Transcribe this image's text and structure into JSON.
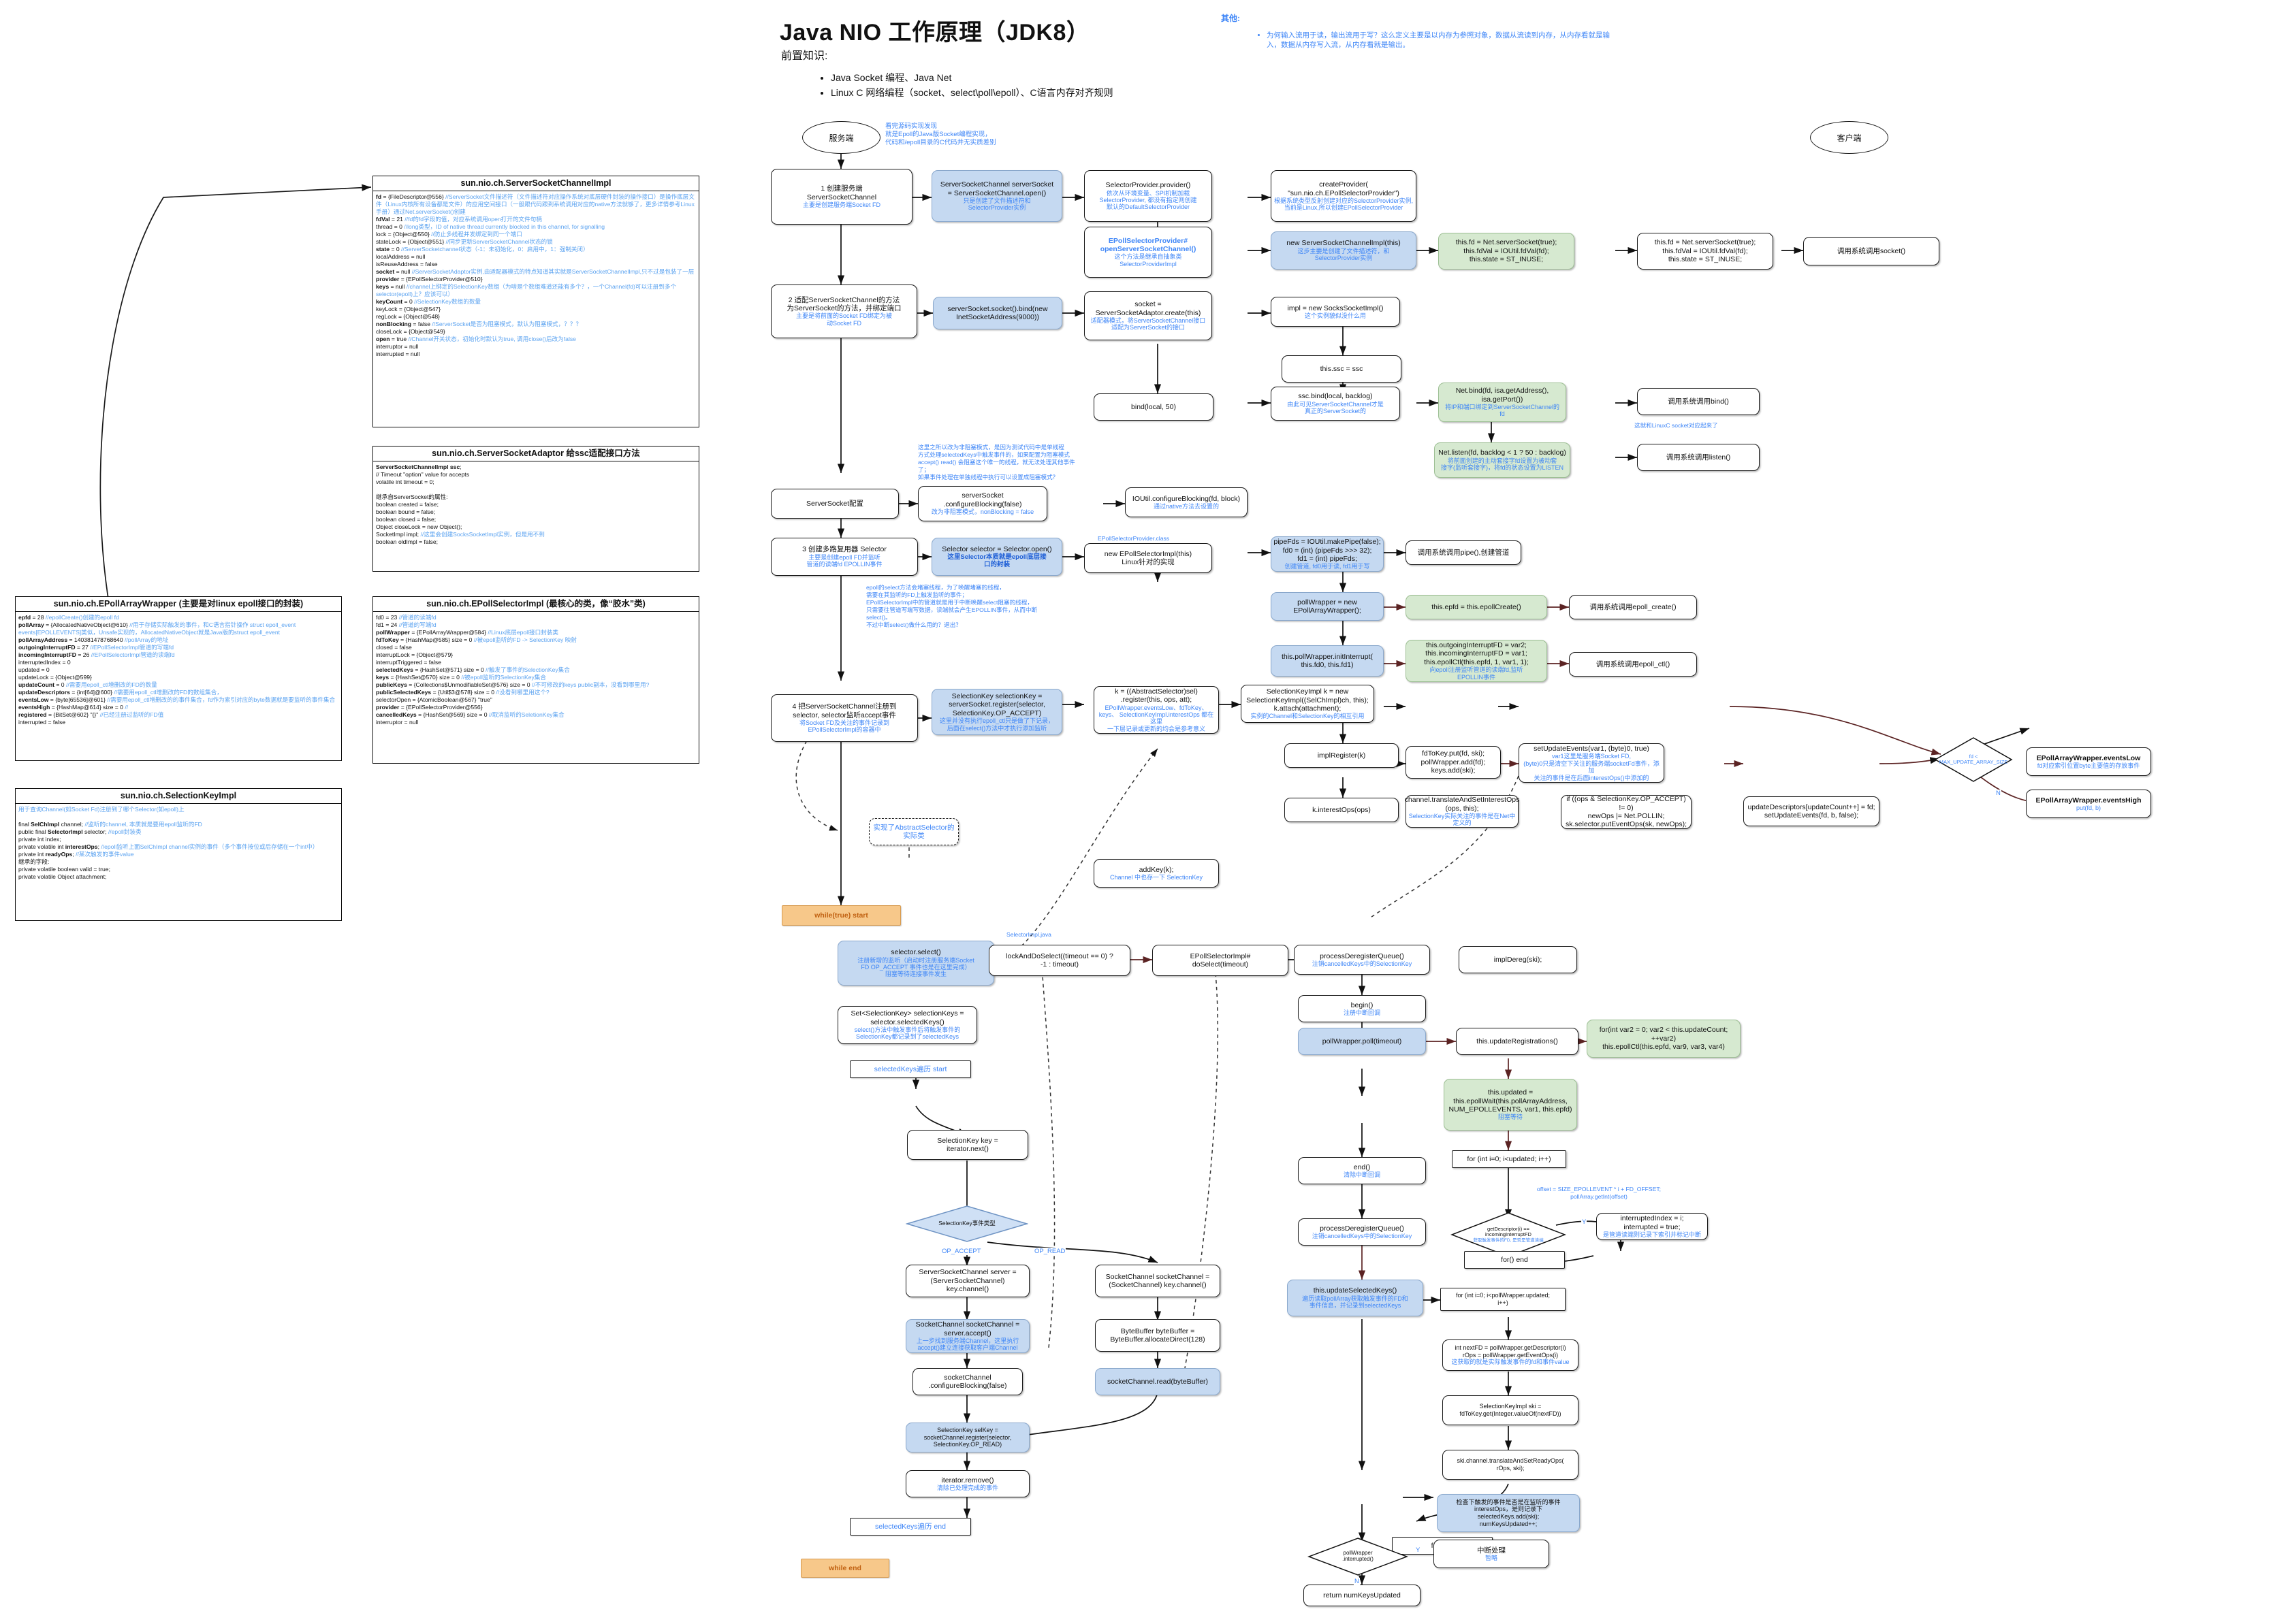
{
  "title": "Java NIO 工作原理（JDK8）",
  "prerequisite": {
    "label": "前置知识:",
    "items": [
      "Java Socket 编程、Java Net",
      "Linux C 网络编程（socket、select\\poll\\epoll）、C语言内存对齐规则"
    ]
  },
  "other": {
    "label": "其他:",
    "items": [
      "为何输入流用于读，输出流用于写？这么定义主要是以内存为参照对象，数据从流读到内存，从内存看就是输入，数据从内存写入流，从内存看就是输出。"
    ]
  },
  "classboxes": [
    {
      "id": "ssci",
      "title": "sun.nio.ch.ServerSocketChannelImpl",
      "lines": [
        "<b>fd</b> = {FileDescriptor@556} <c>//ServerSocket文件描述符（文件描述符对应操作系统对底层硬件封装的操作接口）是操作底层文件（Linux内核所有设备都是文件）的应用空间接口（一般跟代码跟到系统调用对应的native方法就够了，更多详情参考Linux手册）通过Net.serverSocket()创建</c>",
        "<b>fdVal</b> = 21 <c>//fd的fd字段的值，对应系统调用open打开的文件句柄</c>",
        "thread = 0 <c>//long类型，ID of native thread currently blocked in this channel, for signalling</c>",
        "lock = {Object@550}  <c>//防止多线程并发绑定到同一个端口</c>",
        "stateLock = {Object@551} <c>//同步更新ServerSocketChannel状态的锁</c>",
        "<b>state</b> = 0 <c>//ServerSocketchannel状态（-1：未初始化，0：启用中，1：强制关闭）</c>",
        "localAddress = null",
        "isReuseAddress = false",
        "<b>socket</b> = null <c>//ServerSocketAdaptor实例,由适配器模式的特点知道其实就是ServerSocketChannelImpl,只不过是包装了一层</c>",
        "<b>provider</b> = {EPollSelectorProvider@510}",
        "<b>keys</b> = null <c>//channel上绑定的SelectionKey数组（为啥是个数组难道还能有多个？，一个Channel(fd)可以注册到多个selector(epoll)上？应该可以）</c>",
        "<b>keyCount</b> = 0 <c>//SelectionKey数组的数量</c>",
        "keyLock = {Object@547}",
        "regLock = {Object@548}",
        "<b>nonBlocking</b> = false <c>//ServerSocket是否为阻塞模式，默认为阻塞模式，？？？</c>",
        "closeLock = {Object@549}",
        "<b>open</b> = true    <c>//Channel开关状态，初始化时默认为true, 调用close()后改为false</c>",
        "interruptor = null",
        "interrupted = null"
      ]
    },
    {
      "id": "ssa",
      "title": "sun.nio.ch.ServerSocketAdaptor    给ssc适配接口方法",
      "lines": [
        "<b>ServerSocketChannelImpl ssc</b>;",
        "// Timeout \"option\" value for accepts",
        "volatile int timeout = 0;",
        "&nbsp;",
        "继承自ServerSocket的属性:",
        "boolean created = false;",
        "boolean bound = false;",
        "boolean closed = false;",
        "Object closeLock = new Object();",
        "SocketImpl impl; <c>//这里会创建SocksSocketImpl实例，但是用不到</c>",
        "boolean oldImpl = false;"
      ]
    },
    {
      "id": "epaw",
      "title": "sun.nio.ch.EPollArrayWrapper (主要是对linux epoll接口的封装)",
      "lines": [
        "<b>epfd</b> = 28              <c>//epollCreate()创建的epoll fd</c>",
        "<b>pollArray</b> = {AllocatedNativeObject@610} <c>//用于存储实际触发的事件，和C语言指针操作 struct epoll_event events[EPOLLEVENTS]类似，Unsafe实现的，AllocatedNativeObject就是Java版的struct epoll_event</c>",
        "<b>pollArrayAddress</b> = 140381478768640    <c>//pollArray的地址</c>",
        "<b>outgoingInterruptFD</b> = 27        <c>//EPollSelectorImpl管道的写端fd</c>",
        "<b>incomingInterruptFD</b> = 26        <c>//EPollSelectorImpl管道的读端fd</c>",
        "interruptedIndex = 0",
        "updated = 0",
        "updateLock = {Object@599}",
        "<b>updateCount</b> = 0                <c>//需要用epoll_ctl增删改的FD的数量</c>",
        "<b>updateDescriptors</b> = {int[64]@600} <c>//需要用epoll_ctl增删改的FD的数组集合，</c>",
        "<b>eventsLow</b> = {byte[65536]@601}       <c>//需要用epoll_ctl增删改的的事件集合，fd作为索引对应的byte数据就是要监听的事件集合</c>",
        "<b>eventsHigh</b> = {HashMap@614}  size = 0   <c>//</c>",
        "<b>registered</b> = {BitSet@602} \"{}\" <c>//已经注册过监听的FD值</c>",
        "interrupted = false"
      ]
    },
    {
      "id": "epsi",
      "title": "sun.nio.ch.EPollSelectorImpl (最核心的类，像“胶水”类)",
      "lines": [
        "fd0 = 23 <c>//管道的读端fd</c>",
        "fd1 = 24 <c>//管道的写端fd</c>",
        "<b>pollWrapper</b> = {EPollArrayWrapper@584} <c>//Linux底层epoll接口封装类</c>",
        "<b>fdToKey</b> = {HashMap@585} size = 0 <c>//被epoll监听的FD -> SelectionKey 映射</c>",
        "closed = false",
        "interruptLock = {Object@579}",
        "interruptTriggered = false",
        "<b>selectedKeys</b> = {HashSet@571} size = 0     <c>//触发了事件的SelectionKey集合</c>",
        "<b>keys</b> = {HashSet@570} size = 0 <c>//被epoll监听的SelectionKey集合</c>",
        "<b>publicKeys</b> = {Collections$UnmodifiableSet@576} size = 0 <c>//不可修改的keys public副本，没看到哪里用?</c>",
        "<b>publicSelectedKeys</b> = {Util$3@578} size = 0 <c>//没看到哪里用这个?</c>",
        "selectorOpen = {AtomicBoolean@567} \"true\"",
        "<b>provider</b> = {EPollSelectorProvider@556}",
        "<b>cancelledKeys</b> = {HashSet@569} size = 0  <c>//取消监听的SeletionKey集合</c>",
        "interruptor = null"
      ]
    },
    {
      "id": "ski",
      "title": "sun.nio.ch.SelectionKeyImpl",
      "lines": [
        "<c>用于查询Channel(如Socket Fd)注册到了哪个Selector(如epoll)上</c>",
        "&nbsp;",
        "final <b>SelChImpl</b> channel; <c>//监听的channel, 本质就是要用epoll监听的FD</c>",
        "public final <b>SelectorImpl</b> selector; <c>//epoll封装类</c>",
        "private int index;",
        "private volatile int <b>interestOps</b>; <c>//epoll监听上面SelChImpl channel实例的事件（多个事件按位或后存储在一个int中）</c>",
        "private int <b>readyOps</b>;   <c>//某次触发的事件value</c>",
        "继承的字段:",
        "private volatile boolean valid = true;",
        "private volatile Object attachment;"
      ]
    }
  ],
  "lanes": {
    "server": "服务端",
    "client": "客户端"
  },
  "nodes": {
    "n_server_note": "看完源码实现发现\n就是Epoll的Java版Socket编程实现，\n代码和/epoll目录的C代码并无实质差别",
    "n1": {
      "main": "1 创建服务端\nServerSocketChannel",
      "sub": "主要是创建服务端Socket FD"
    },
    "n1r": {
      "main": "ServerSocketChannel serverSocket\n= ServerSocketChannel.open()",
      "sub": "只是创建了文件描述符和\nSelectorProvider实例"
    },
    "n_sp_provider": {
      "main": "SelectorProvider.provider()",
      "sub": "依次从环境变量、SPI机制加载\nSelectorProvider, 都没有指定则创建\n默认的DefaultSelectorProvider"
    },
    "n_createprovider": {
      "main": "createProvider(\n\"sun.nio.ch.EPollSelectorProvider\")",
      "sub": "根据系统类型反射创建对应的SelectorProvider实例,\n当前是Linux,所以创建EPollSelectorProvider"
    },
    "n_openssc": {
      "main": "EPollSelectorProvider#\nopenServerSocketChannel()",
      "sub": "这个方法是继承自抽象类\nSelectorProviderImpl"
    },
    "n_newsscimpl": {
      "main": "new ServerSocketChannelImpl(this)",
      "sub": "这步主要是创建了文件描述符，和\nSelectorProvider实例"
    },
    "n_netserversocket_g": {
      "main": "this.fd = Net.serverSocket(true);\nthis.fdVal = IOUtil.fdVal(fd);\nthis.state = ST_INUSE;"
    },
    "n_netserversocket_w": {
      "main": "this.fd = Net.serverSocket(true);\nthis.fdVal = IOUtil.fdVal(fd);\nthis.state = ST_INUSE;"
    },
    "n_syscall_socket": {
      "main": "调用系统调用socket()"
    },
    "n2": {
      "main": "2 适配ServerSocketChannel的方法\n为ServerSocket的方法，并绑定端口",
      "sub": "主要是将前面的Socket FD绑定为被\n动Socket FD"
    },
    "n2r": {
      "main": "serverSocket.socket().bind(new\nInetSocketAddress(9000))"
    },
    "n_ssa_create": {
      "main": "socket =\nServerSocketAdaptor.create(this)",
      "sub": "适配器模式，将ServerSocketChannel接口\n适配为ServerSocket的接口"
    },
    "n_socksimpl": {
      "main": "impl = new SocksSocketImpl()",
      "sub": "这个实例貌似没什么用"
    },
    "n_thisssc": {
      "main": "this.ssc = ssc"
    },
    "n_bindlocal50": {
      "main": "bind(local, 50)"
    },
    "n_sscbind": {
      "main": "ssc.bind(local, backlog)",
      "sub": "由此可见ServerSocketChannel才是\n真正的ServerSocket的"
    },
    "n_netbind": {
      "main": "Net.bind(fd, isa.getAddress(),\nisa.getPort())",
      "sub": "将IP和端口绑定到ServerSocketChannel的\nfd"
    },
    "n_syscall_bind": {
      "main": "调用系统调用bind()"
    },
    "n_netlisten": {
      "main": "Net.listen(fd, backlog < 1 ? 50 : backlog)",
      "sub": "将前面创建的主动套接字fd设置为被动套\n接字(监听套接字)，将fd的状态设置为LISTEN"
    },
    "n_syscall_listen": {
      "main": "调用系统调用listen()"
    },
    "n_linuxc_note": "这就和LinuxC socket对应起来了",
    "n3cfg": {
      "main": "ServerSocket配置"
    },
    "n3cfg_r": {
      "main": "serverSocket\n.configureBlocking(false)",
      "sub": "改为非阻塞模式，nonBlocking = false"
    },
    "n3cfg_note": "这里之所以改为非阻塞模式，是因为测试代码中是单线程\n方式处理selectedKeys中触发事件的，如果配置为阻塞模式\naccept() read() 会阻塞这个唯一的线程，就无法处理其他事件\n了；\n如果事件处理在单独线程中执行可以设置成阻塞模式？",
    "n_ioutilcfgblk": {
      "main": "IOUtil.configureBlocking(fd, block)",
      "sub": "通过native方法去设置的"
    },
    "n3": {
      "main": "3 创建多路复用器 Selector",
      "sub": "主要是创建epoll FD并监听\n管道的读端fd EPOLLIN事件"
    },
    "n3r": {
      "main": "Selector selector = Selector.open()",
      "subb": "这里Selector本质就是epoll底层接\n口的封装"
    },
    "n3r2": {
      "main": "EPollSelectorProvider.class"
    },
    "n3r3": {
      "main": "new EPollSelectorImpl(this)\nLinux针对的实现"
    },
    "n3_note": "epoll的select方法会堵塞线程，为了唤醒堵塞的线程，\n需要在其监听的FD上触发监听的事件；\nEPollSelectorImpl中的管道就是用于中断唤醒select阻塞的线程，\n只需要往管道写端写数据，读端就会产生EPOLLIN事件，从而中断\nselect()。\n不过中断select()做什么用的？退出？",
    "n_makepipe": {
      "main": "pipeFds = IOUtil.makePipe(false);\nfd0 = (int) (pipeFds >>> 32);\nfd1 = (int) pipeFds;",
      "sub": "创建管道, fd0用于读, fd1用于写"
    },
    "n_syscall_pipe": {
      "main": "调用系统调用pipe(),创建管道"
    },
    "n_newepaw": {
      "main": "pollWrapper = new\nEPollArrayWrapper();"
    },
    "n_epollcreate": {
      "main": "this.epfd = this.epollCreate()"
    },
    "n_syscall_epollcreate": {
      "main": "调用系统调用epoll_create()"
    },
    "n_initinterrupt": {
      "main": "this.pollWrapper.initInterrupt(\nthis.fd0, this.fd1)"
    },
    "n_epollctl_init": {
      "main": "this.outgoingInterruptFD = var2;\nthis.incomingInterruptFD = var1;\nthis.epollCtl(this.epfd, 1, var1, 1);",
      "sub": "向epoll注册监听管道的读端fd,监听\nEPOLLIN事件"
    },
    "n_syscall_epollctl": {
      "main": "调用系统调用epoll_ctl()"
    },
    "n4": {
      "main": "4 把ServerSocketChannel注册到\nselector, selector监听accept事件",
      "sub": "将Socket FD及关注的事件记录到\nEPollSelectorImpl的容器中"
    },
    "n4r": {
      "main": "SelectionKey selectionKey =\nserverSocket.register(selector,\nSelectionKey.OP_ACCEPT)",
      "sub": "这里并没有执行epoll_ctl只是做了下记录，\n后面在select()方法中才执行添加监听"
    },
    "n_abstractselector": {
      "main": "k = ((AbstractSelector)sel)\n.register(this, ops, att);",
      "sub": "EPollWrapper.eventsLow、fdToKey、\nkeys、 SelectionKeyImpl.interestOps 都在这里\n一下层记录或更新的均会是参考意义"
    },
    "n_newski": {
      "main": "SelectionKeyImpl k = new\nSelectionKeyImpl((SelChImpl)ch, this);\nk.attach(attachment);",
      "sub": "实例的Channel和SelectionKey的相互引用"
    },
    "n_implregister": {
      "main": "implRegister(k)"
    },
    "n_fdtokeyput": {
      "main": "fdToKey.put(fd, ski);\npollWrapper.add(fd);\nkeys.add(ski);"
    },
    "n_setupdateevents": {
      "main": "setUpdateEvents(var1, (byte)0, true)",
      "sub": "var1这里是服务端Socket FD,\n(byte)0只是清空下关注的服务端socketFd事件，添加\n关注的事件是在后面interestOps()中添加的"
    },
    "n_kinterestops": {
      "main": "k.interestOps(ops)"
    },
    "n_translate": {
      "main": "channel.translateAndSetInterestOps\n(ops, this);",
      "sub": "SelectionKey实际关注的事件是在Net中定义的"
    },
    "n_ifops": {
      "main": "if ((ops & SelectionKey.OP_ACCEPT) != 0)\nnewOps |= Net.POLLIN;\nsk.selector.putEventOps(sk, newOps);"
    },
    "n_updatedesc": {
      "main": "updateDescriptors[updateCount++] = fd;\nsetUpdateEvents(fd, b, false);"
    },
    "n_diamond_maxupdate": {
      "main": "fd <\nMAX_UPDATE_ARRAY_SIZE"
    },
    "n_eventslow": {
      "main": "EPollArrayWrapper.eventsLow",
      "sub": "fd对应索引位置byte主要值的存放事件"
    },
    "n_eventshigh": {
      "main": "EPollArrayWrapper.eventsHigh",
      "sub": "put(fd, b)"
    },
    "n_addkeyk": {
      "main": "addKey(k);",
      "sub": "Channel 中也存一下 SelectionKey"
    },
    "n_note_epollsel": "实现了AbstractSelector的\n实际类",
    "n_whilestart": {
      "main": "while(true) start"
    },
    "n_selectorselect": {
      "main": "selector.select()",
      "sub": "注册新增的监听（启动时注册服务端Socket\nFD OP_ACCEPT 事件也是在这里完成）\n阻塞等待连接事件发生"
    },
    "n_lockanddoselect": {
      "main": "lockAndDoSelect((timeout == 0) ?\n-1 : timeout)"
    },
    "n_selectorimpl_java": "SelectorImpl.java",
    "n_epollselimpl_doselect": {
      "main": "EPollSelectorImpl#\ndoSelect(timeout)"
    },
    "n_processdereg1": {
      "main": "processDeregisterQueue()",
      "sub": "注销cancelledKeys中的SelectionKey"
    },
    "n_impldereg": {
      "main": "implDereg(ski);"
    },
    "n_begin": {
      "main": "begin()",
      "sub": "注册中断回调"
    },
    "n_pollwrapperpoll": {
      "main": "pollWrapper.poll(timeout)"
    },
    "n_updateregistrations": {
      "main": "this.updateRegistrations()"
    },
    "n_forvar2": {
      "main": "for(int var2 = 0; var2 < this.updateCount;\n++var2)\nthis.epollCtl(this.epfd, var9, var3, var4)"
    },
    "n_epollwait": {
      "main": "this.updated =\nthis.epollWait(this.pollArrayAddress,\nNUM_EPOLLEVENTS, var1, this.epfd)",
      "sub": "阻塞等待"
    },
    "n_forupdated": {
      "main": "for (int i=0; i<updated; i++)"
    },
    "n_offsetnote": "offset = SIZE_EPOLLEVENT * i + FD_OFFSET;\npollArray.getInt(offset)",
    "n_diamond_incoming": {
      "main": "getDescriptor(i) ==\nincomingInterruptFD",
      "sub": "获取触发事件的FD, 是否是管道读端"
    },
    "n_interruptedindex": {
      "main": "interruptedIndex = i;\ninterrupted = true;",
      "sub": "是管道读端则记录下索引并标记中断"
    },
    "n_forend1": {
      "main": "for() end"
    },
    "n_end": {
      "main": "end()",
      "sub": "清除中断回调"
    },
    "n_processdereg2": {
      "main": "processDeregisterQueue()",
      "sub": "注销cancelledKeys中的SelectionKey"
    },
    "n_updateselectedkeys": {
      "main": "this.updateSelectedKeys()",
      "sub": "遍历读取pollArray获取触发事件的FD和\n事件信息，并记录到selectedKeys"
    },
    "n_forpollwrapper": {
      "main": "for (int i=0; i<pollWrapper.updated;\ni++)"
    },
    "n_nextfd": {
      "main": "int nextFD = pollWrapper.getDescriptor(i)\nrOps = pollWrapper.getEventOps(i)",
      "sub": "这获取的就是实际触发事件的fd和事件value"
    },
    "n_skiget": {
      "main": "SelectionKeyImpl ski =\nfdToKey.get(Integer.valueOf(nextFD))"
    },
    "n_translateready": {
      "main": "ski.channel.translateAndSetReadyOps(\nrOps, ski);"
    },
    "n_checkinterest": {
      "main": "检查下触发的事件是否是在监听的事件\ninterestOps，是则记录下\nselectedKeys.add(ski);\nnumKeysUpdated++;"
    },
    "n_forend2": {
      "main": "for end"
    },
    "n_diamond_interrupted": {
      "main": "pollWrapper\n.interrupted()"
    },
    "n_interrupthandle": {
      "main": "中断处理",
      "sub": "暂略"
    },
    "n_returnnum": {
      "main": "return numKeysUpdated"
    },
    "n_setselkeys": {
      "main": "Set<SelectionKey> selectionKeys =\nselector.selectedKeys()",
      "sub": "select()方法中触发事件后将触发事件的\nSelectionKey都记录到了selectedKeys"
    },
    "n_selkeys_start": {
      "main": "selectedKeys遍历 start"
    },
    "n_iteratornext": {
      "main": "SelectionKey key =\niterator.next()"
    },
    "n_diamond_eventtype": {
      "main": "SelectionKey事件类型"
    },
    "n_op_accept": "OP_ACCEPT",
    "n_op_read": "OP_READ",
    "n_serverchannel": {
      "main": "ServerSocketChannel server =\n(ServerSocketChannel)\nkey.channel()"
    },
    "n_serveraccept": {
      "main": "SocketChannel socketChannel =\nserver.accept()",
      "sub": "上一步找到服务端Channel，这里执行\naccept()建立连接获取客户端Channel"
    },
    "n_sockcfgblock": {
      "main": "socketChannel\n.configureBlocking(false)"
    },
    "n_selkeyregister": {
      "main": "SelectionKey selKey =\nsocketChannel.register(selector,\nSelectionKey.OP_READ)"
    },
    "n_sockchannel_read_cast": {
      "main": "SocketChannel socketChannel =\n(SocketChannel) key.channel()"
    },
    "n_bytebuffer": {
      "main": "ByteBuffer byteBuffer =\nByteBuffer.allocateDirect(128)"
    },
    "n_sockread": {
      "main": "socketChannel.read(byteBuffer)"
    },
    "n_iteratorremove": {
      "main": "iterator.remove()",
      "sub": "清除已处理完成的事件"
    },
    "n_selkeys_end": {
      "main": "selectedKeys遍历 end"
    },
    "n_whileend": {
      "main": "while end"
    },
    "yes": "Y",
    "no": "N"
  }
}
